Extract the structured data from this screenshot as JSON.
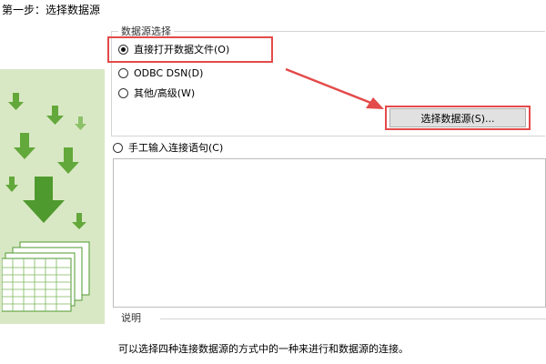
{
  "step_title": "第一步：选择数据源",
  "data_source_group": {
    "title": "数据源选择",
    "options": [
      {
        "label": "直接打开数据文件(O)",
        "checked": true
      },
      {
        "label": "ODBC DSN(D)",
        "checked": false
      },
      {
        "label": "其他/高级(W)",
        "checked": false
      }
    ],
    "select_button_label": "选择数据源(S)..."
  },
  "manual_option": {
    "label": "手工输入连接语句(C)",
    "checked": false
  },
  "connection_text": "",
  "description": {
    "title": "说明",
    "text": "可以选择四种连接数据源的方式中的一种来进行和数据源的连接。"
  },
  "colors": {
    "highlight": "#e34a4a",
    "illustration_bg": "#d9e8c4",
    "arrow_green": "#4f9a2f"
  },
  "icons": [
    "down-arrow-icon",
    "spreadsheet-icon",
    "arrow-annotation-icon"
  ]
}
